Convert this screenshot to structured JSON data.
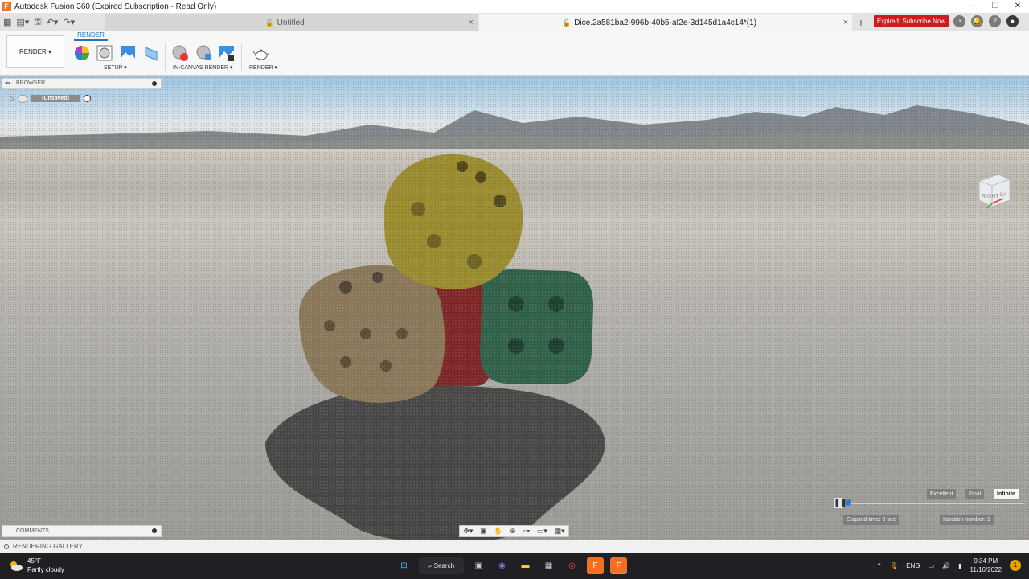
{
  "window": {
    "title": "Autodesk Fusion 360 (Expired Subscription - Read Only)",
    "app_logo": "F",
    "minimize": "—",
    "restore": "❐",
    "close": "✕"
  },
  "tabs": [
    {
      "label": "Untitled",
      "close": "×"
    },
    {
      "label": "Dice.2a581ba2-996b-40b5-af2e-3d145d1a4c14*(1)",
      "close": "×"
    }
  ],
  "new_tab": "+",
  "subscribe_button": "Expired: Subscribe Now",
  "ribbon": {
    "workspace": "RENDER ▾",
    "active_tab": "RENDER",
    "groups": {
      "setup": "SETUP ▾",
      "in_canvas": "IN-CANVAS RENDER ▾",
      "render": "RENDER ▾"
    }
  },
  "browser": {
    "collapse": "◂◂",
    "label": "BROWSER",
    "root_item": "(Unsaved)"
  },
  "comments": {
    "label": "COMMENTS"
  },
  "viewcube": {
    "right": "RIGHT",
    "back": "BA"
  },
  "render_controls": {
    "quality_options": [
      "Excellent",
      "Final",
      "Infinite"
    ],
    "selected_quality": "Infinite",
    "pause": "❚❚",
    "elapsed_time": "Elapsed time: 0 sec",
    "iteration": "Iteration number: 1",
    "progress": 0.02
  },
  "gallery": {
    "label": "RENDERING GALLERY"
  },
  "taskbar": {
    "temperature": "45°F",
    "condition": "Partly cloudy",
    "search": "Search",
    "lang": "ENG",
    "time": "9:34 PM",
    "date": "11/16/2022",
    "notification_count": "1"
  },
  "colors": {
    "accent": "#1a78c2",
    "subscribe_red": "#d11a1a",
    "die_yellow": "#9a8c2c",
    "die_tan": "#8a7658",
    "die_green": "#2e6048",
    "die_red": "#7a1c1c"
  }
}
